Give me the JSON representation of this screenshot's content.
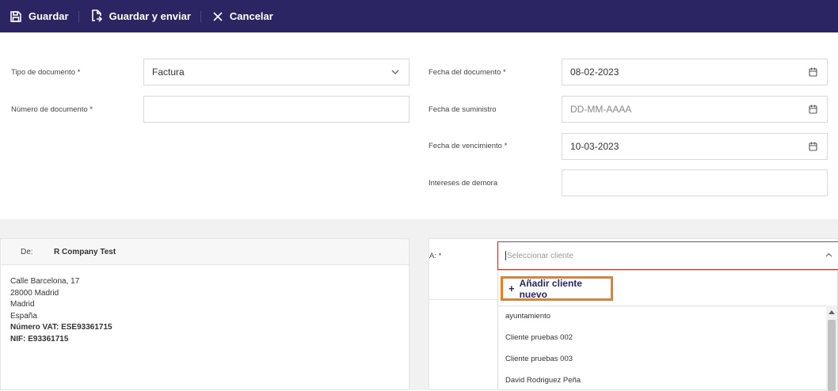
{
  "toolbar": {
    "save_label": "Guardar",
    "save_send_label": "Guardar y enviar",
    "cancel_label": "Cancelar"
  },
  "form": {
    "doc_type_label": "Tipo de documento *",
    "doc_type_value": "Factura",
    "doc_number_label": "Número de documento *",
    "doc_number_value": "",
    "doc_date_label": "Fecha del documento *",
    "doc_date_value": "08-02-2023",
    "supply_date_label": "Fecha de suministro",
    "supply_date_placeholder": "DD-MM-AAAA",
    "due_date_label": "Fecha de vencimiento *",
    "due_date_value": "10-03-2023",
    "interest_label": "Intereses de demora",
    "interest_value": ""
  },
  "from": {
    "label": "De:",
    "company": "R Company Test",
    "address_lines": [
      "Calle Barcelona, 17",
      "28000 Madrid",
      "Madrid",
      "España"
    ],
    "vat": "Número VAT: ESE93361715",
    "nif": "NIF: E93361715"
  },
  "to": {
    "label": "A: *",
    "select_placeholder": "Seleccionar cliente",
    "add_new_label": "Añadir cliente nuevo",
    "clients": [
      "ayuntamiento",
      "Cliente pruebas 002",
      "Cliente pruebas 003",
      "David Rodriguez Peña"
    ]
  },
  "icons": {
    "save": "save-icon",
    "save_send": "document-send-icon",
    "cancel": "close-icon",
    "calendar": "calendar-icon",
    "chevron_down": "chevron-down-icon",
    "chevron_up": "chevron-up-icon"
  },
  "colors": {
    "toolbar_bg": "#2b2663",
    "highlight": "#f07d1a",
    "error_border": "#c0392b"
  }
}
